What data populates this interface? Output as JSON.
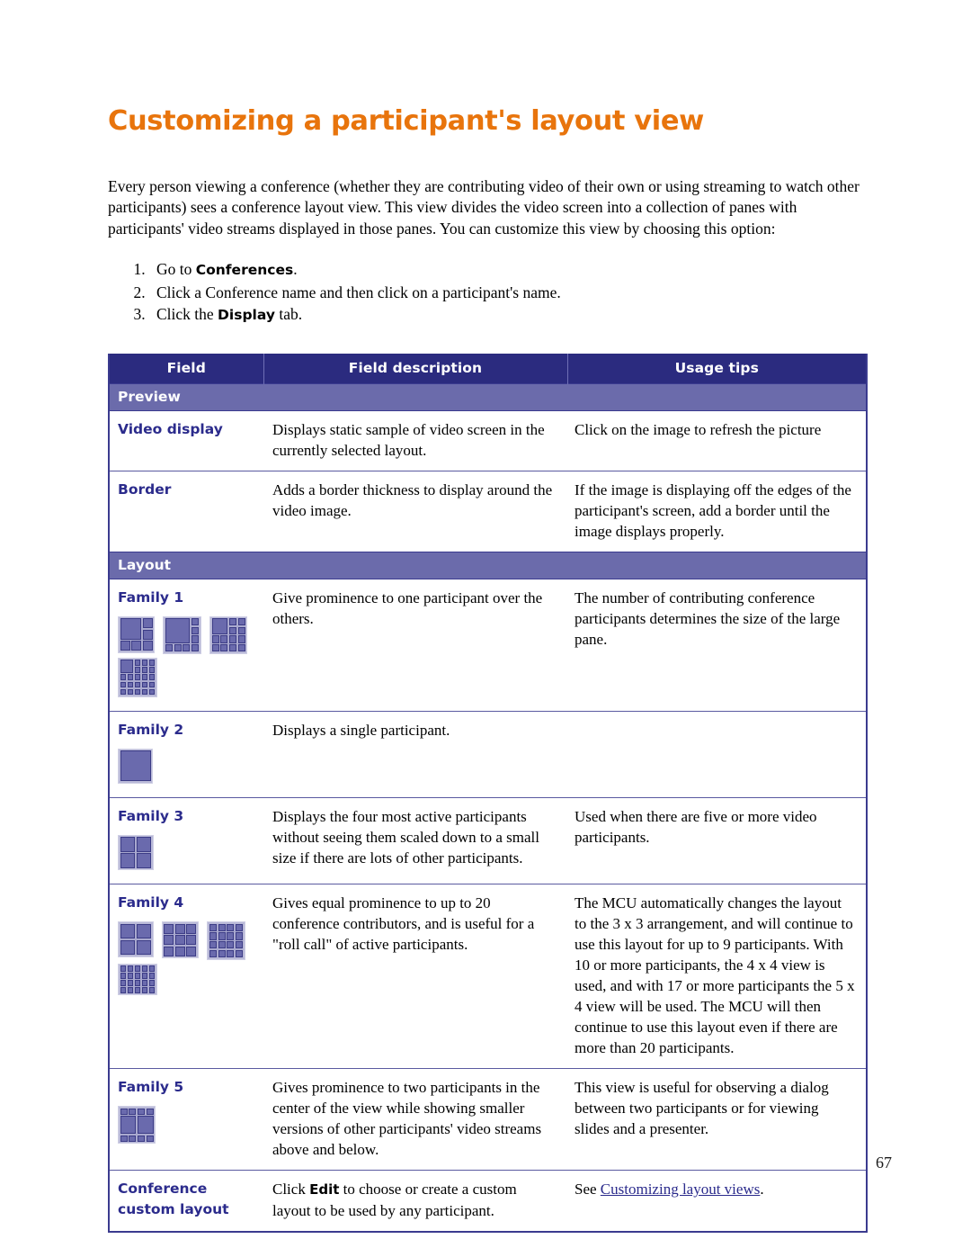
{
  "document": {
    "title": "Customizing a participant's layout view",
    "title_color": "#E8740C",
    "page_number": "67",
    "intro": "Every person viewing a conference (whether they are contributing video of their own or using streaming to watch other participants) sees a conference layout view. This view divides the video screen into a collection of panes with participants' video streams displayed in those panes. You can customize this view by choosing this option:",
    "steps": [
      {
        "pre": "Go to ",
        "bold": "Conferences",
        "post": "."
      },
      {
        "pre": "Click a Conference name and then click on a participant's name.",
        "bold": "",
        "post": ""
      },
      {
        "pre": "Click the ",
        "bold": "Display",
        "post": " tab."
      }
    ]
  },
  "table": {
    "headers": {
      "field": "Field",
      "description": "Field description",
      "tips": "Usage tips"
    },
    "colors": {
      "header_bg": "#2b2b7f",
      "section_bg": "#6b6bab",
      "field_text": "#2b2b8c",
      "pane_fill": "#6a6aad",
      "pane_border": "#3c3c86"
    },
    "sections": [
      {
        "label": "Preview",
        "rows": [
          {
            "field": "Video display",
            "description": "Displays static sample of video screen in the currently selected layout.",
            "tips": "Click on the image to refresh the picture",
            "icons": []
          },
          {
            "field": "Border",
            "description": "Adds a border thickness to display around the video image.",
            "tips": "If the image is displaying off the edges of the participant's screen, add a border until the image displays properly.",
            "icons": []
          }
        ]
      },
      {
        "label": "Layout",
        "rows": [
          {
            "field": "Family 1",
            "description": "Give prominence to one participant over the others.",
            "tips": "The number of contributing conference participants determines the size of the large pane.",
            "icons": [
              "family1-1",
              "family1-2",
              "family1-3",
              "family1-4"
            ]
          },
          {
            "field": "Family 2",
            "description": "Displays a single participant.",
            "tips": "",
            "icons": [
              "family2-1"
            ]
          },
          {
            "field": "Family 3",
            "description": "Displays the four most active participants without seeing them scaled down to a small size if there are lots of other participants.",
            "tips": "Used when there are five or more video participants.",
            "icons": [
              "family3-1"
            ]
          },
          {
            "field": "Family 4",
            "description_pre": "Gives equal prominence to up to 20 conference contributors, and is useful for a \"roll call\" of active participants.",
            "description": "Gives equal prominence to up to 20 conference contributors, and is useful for a \"roll call\" of active participants.",
            "tips": "The MCU automatically changes the layout to the 3 x 3 arrangement, and will continue to use this layout for up to 9 participants. With 10 or more participants, the 4 x 4 view is used, and with 17 or more participants the 5 x 4 view will be used. The MCU will then continue to use this layout even if there are more than 20 participants.",
            "icons": [
              "family4-1",
              "family4-2",
              "family4-3",
              "family4-4"
            ]
          },
          {
            "field": "Family 5",
            "description": "Gives prominence to two participants in the center of the view while showing smaller versions of other participants' video streams above and below.",
            "tips": "This view is useful for observing a dialog between two participants or for viewing slides and a presenter.",
            "icons": [
              "family5-1"
            ]
          },
          {
            "field": "Conference custom layout",
            "description_parts": {
              "pre": "Click ",
              "bold": "Edit",
              "post": " to choose or create a custom layout to be used by any participant."
            },
            "description": "Click Edit to choose or create a custom layout to be used by any participant.",
            "tips_parts": {
              "pre": "See ",
              "link": "Customizing layout views",
              "post": "."
            },
            "tips": "See Customizing layout views.",
            "icons": []
          }
        ]
      }
    ]
  }
}
